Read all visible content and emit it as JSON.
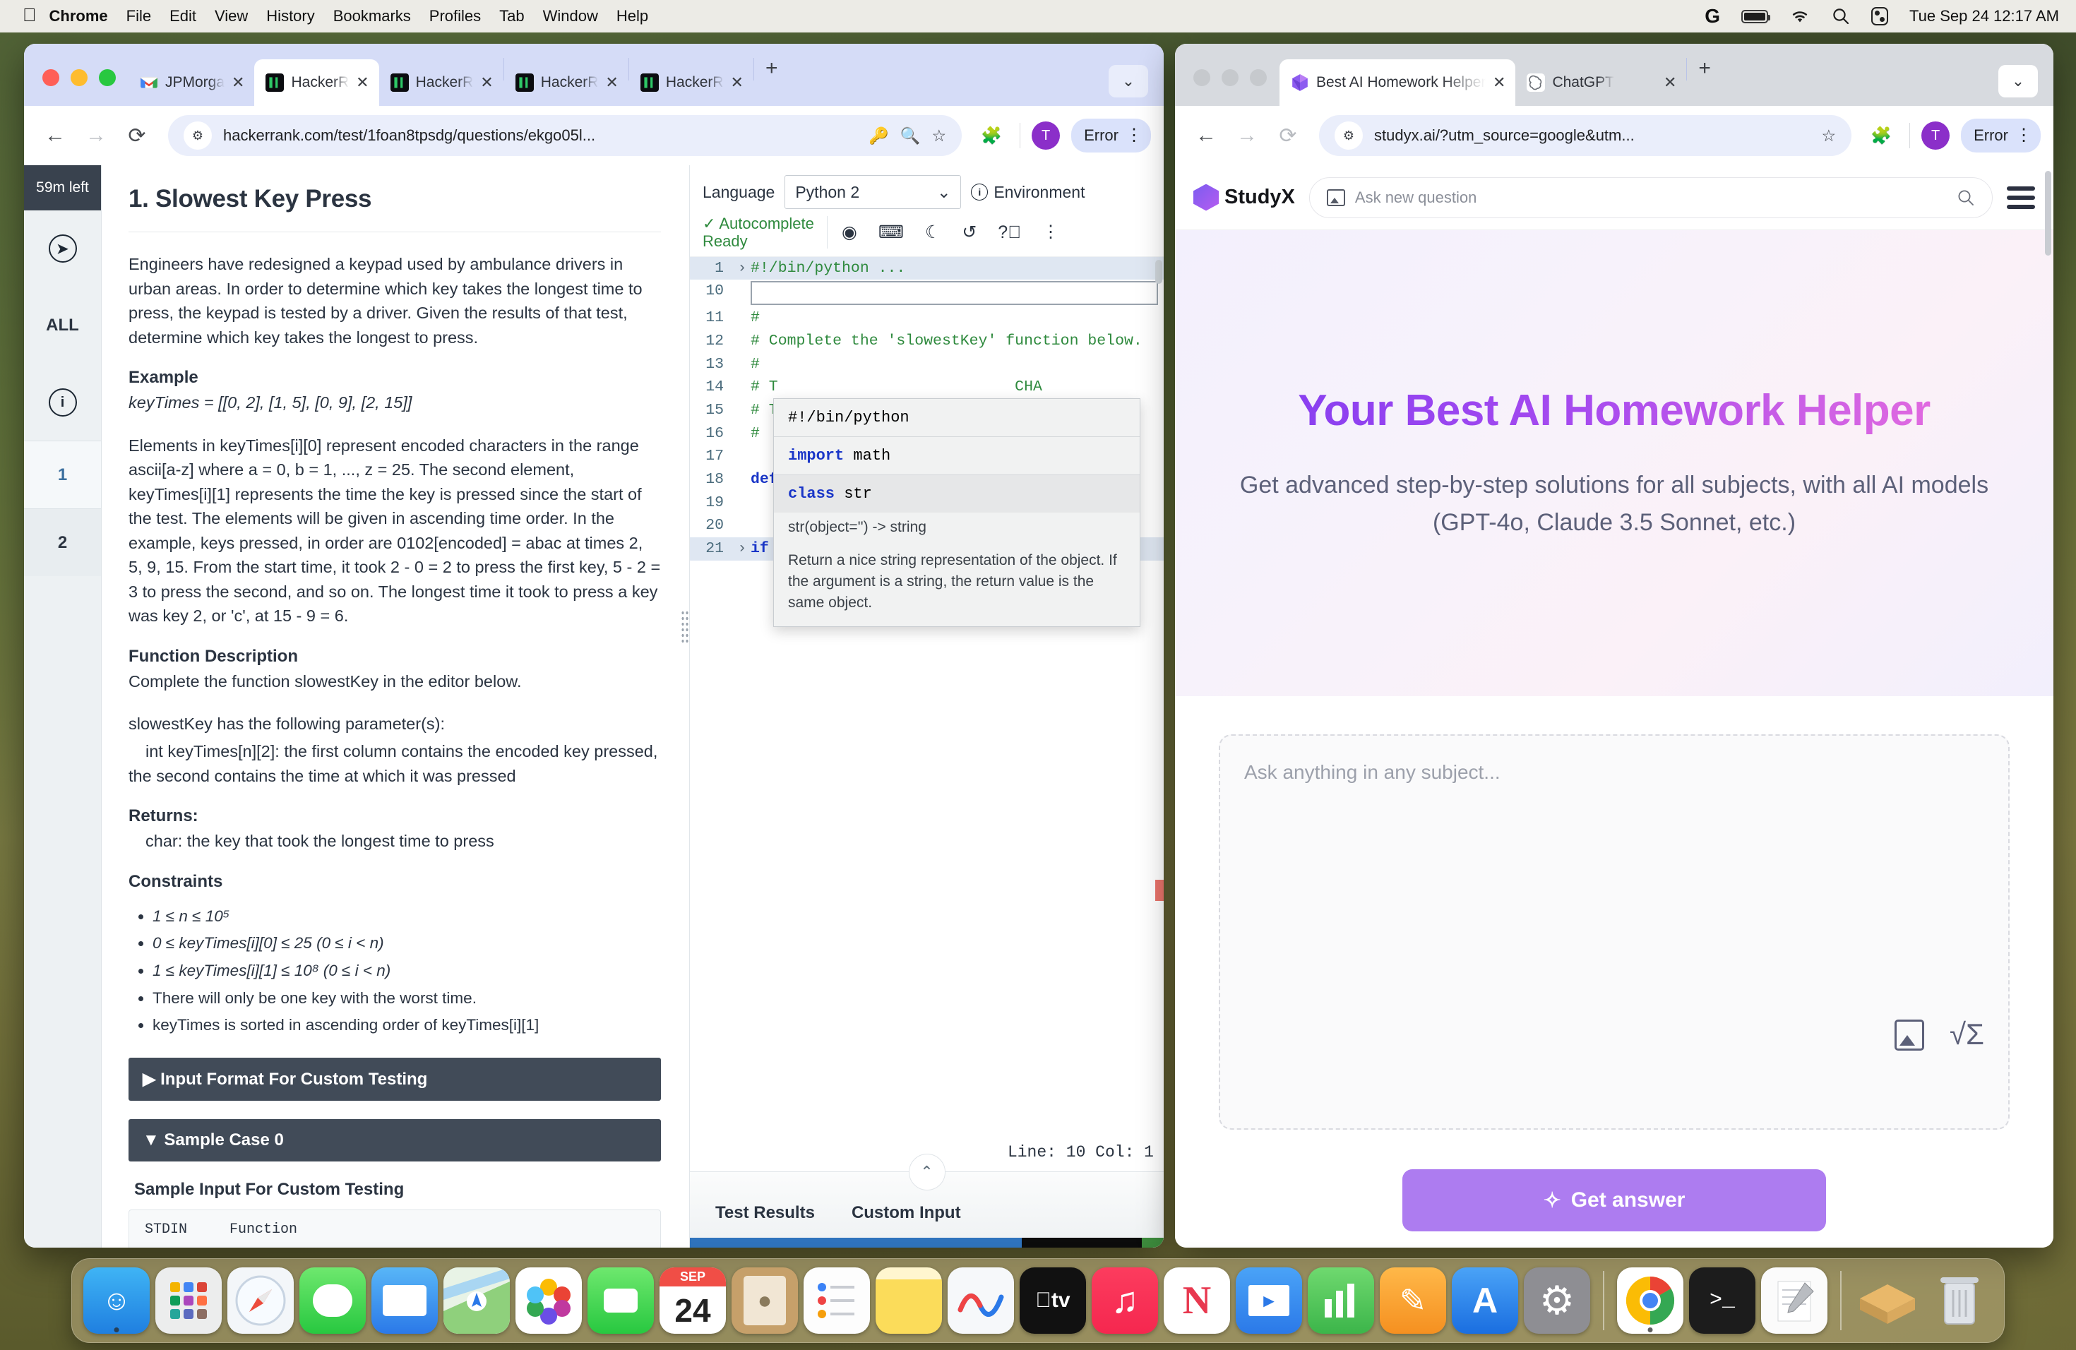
{
  "menubar": {
    "apple": "",
    "items": [
      "Chrome",
      "File",
      "Edit",
      "View",
      "History",
      "Bookmarks",
      "Profiles",
      "Tab",
      "Window",
      "Help"
    ],
    "status_icons": [
      "grammarly-icon",
      "battery-icon",
      "wifi-icon",
      "spotlight-search-icon",
      "control-center-icon"
    ],
    "clock": "Tue Sep 24  12:17 AM"
  },
  "left_window": {
    "tabs": [
      {
        "label": "JPMorga",
        "favicon": "gmail-icon",
        "active": false
      },
      {
        "label": "HackerR",
        "favicon": "hackerrank-icon",
        "active": true
      },
      {
        "label": "HackerR",
        "favicon": "hackerrank-icon",
        "active": false
      },
      {
        "label": "HackerR",
        "favicon": "hackerrank-icon",
        "active": false
      },
      {
        "label": "HackerR",
        "favicon": "hackerrank-icon",
        "active": false
      }
    ],
    "new_tab_label": "+",
    "tab_search_label": "⌄",
    "toolbar": {
      "back": "←",
      "forward": "→",
      "reload": "⟳",
      "url": "hackerrank.com/test/1foan8tpsdg/questions/ekgo05l...",
      "site_icon": "site-settings-icon",
      "omnibox_icons": [
        "password-key-icon",
        "search-icon",
        "bookmark-star-icon"
      ],
      "extensions": "extensions-puzzle-icon",
      "avatar_letter": "T",
      "error_label": "Error",
      "menu": "⋮"
    }
  },
  "hackerrank": {
    "timer": "59m left",
    "sidebar": {
      "nav_icon": "compass-icon",
      "all_label": "ALL",
      "info_icon": "info-icon",
      "questions": [
        "1",
        "2"
      ]
    },
    "title": "1. Slowest Key Press",
    "intro": "Engineers have redesigned a keypad used by ambulance drivers in urban areas. In order to determine which key takes the longest time to press, the keypad is tested by a driver. Given the results of that test, determine which key takes the longest to press.",
    "example_heading": "Example",
    "example_value": "keyTimes = [[0, 2], [1, 5], [0, 9], [2, 15]]",
    "explanation": "Elements in keyTimes[i][0] represent encoded characters in the range ascii[a-z] where a = 0, b = 1, ..., z = 25. The second element, keyTimes[i][1] represents the time the key is pressed since the start of the test.   The elements will be given in ascending time order. In the example, keys pressed, in order are 0102[encoded] = abac at times 2, 5, 9, 15.  From the start time, it took 2 - 0 = 2 to press the first key, 5 - 2 = 3 to press the second, and so on. The longest time it took to press a key was key 2, or 'c', at 15 - 9 = 6.",
    "func_desc_heading": "Function Description",
    "func_desc_body": "Complete the function slowestKey in the editor below.",
    "params_intro": "slowestKey has the following parameter(s):",
    "param_line": "int keyTimes[n][2]:  the first column contains the encoded key pressed, the second contains the time at which it was pressed",
    "returns_heading": "Returns:",
    "returns_body": "char: the key that took the longest time to press",
    "constraints_heading": "Constraints",
    "constraints": [
      "1 ≤ n ≤ 10⁵",
      "0 ≤ keyTimes[i][0] ≤ 25 (0 ≤ i < n)",
      "1 ≤ keyTimes[i][1] ≤ 10⁸ (0 ≤ i < n)",
      "There will only be one key with the worst time.",
      "keyTimes is sorted in ascending order of keyTimes[i][1]"
    ],
    "accordion_input_format": "▶ Input Format For Custom Testing",
    "accordion_sample_case": "▼ Sample Case 0",
    "sample_input_heading": "Sample Input For Custom Testing",
    "sample_cols": [
      "STDIN",
      "Function"
    ]
  },
  "editor": {
    "language_label": "Language",
    "language_value": "Python 2",
    "language_caret": "⌄",
    "environment_label": "Environment",
    "autocomplete_label": "Autocomplete Ready",
    "autocomplete_check": "✓",
    "tool_icons": [
      "eye-icon",
      "keyboard-icon",
      "moon-icon",
      "history-icon",
      "help-icon",
      "more-vertical-icon"
    ],
    "lines": [
      {
        "num": "1",
        "fold": "›",
        "text": "#!/bin/python ...",
        "kind": "comment",
        "highlight": true
      },
      {
        "num": "10",
        "fold": "",
        "text": "",
        "kind": "cursor"
      },
      {
        "num": "11",
        "fold": "",
        "text": "#",
        "kind": "comment"
      },
      {
        "num": "12",
        "fold": "",
        "text": "# Complete the 'slowestKey' function below.",
        "kind": "comment"
      },
      {
        "num": "13",
        "fold": "",
        "text": "#",
        "kind": "comment"
      },
      {
        "num": "14",
        "fold": "",
        "text": "# T                          CHA",
        "kind": "comment"
      },
      {
        "num": "15",
        "fold": "",
        "text": "# T                          key",
        "kind": "comment"
      },
      {
        "num": "16",
        "fold": "",
        "text": "#",
        "kind": "comment"
      },
      {
        "num": "17",
        "fold": "",
        "text": "",
        "kind": "plain"
      },
      {
        "num": "18",
        "fold": "",
        "text": "def",
        "kind": "keyword"
      },
      {
        "num": "19",
        "fold": "",
        "text": "",
        "kind": "plain"
      },
      {
        "num": "20",
        "fold": "",
        "text": "",
        "kind": "plain"
      },
      {
        "num": "21",
        "fold": "›",
        "text": "if __name__ == '__main__': ...",
        "kind": "code"
      }
    ],
    "autocomplete_popup": {
      "item1": "#!/bin/python",
      "item2": "import math",
      "item3": "class str",
      "doc_line1": "str(object='') -> string",
      "doc_line2": "Return a nice string representation of the object. If the argument is a string, the return value is the same object."
    },
    "line_col": "Line: 10 Col: 1",
    "collapse_icon": "⌃",
    "bottom_tabs": [
      "Test Results",
      "Custom Input"
    ]
  },
  "right_window": {
    "tabs": [
      {
        "label": "Best AI Homework Helper",
        "favicon": "studyx-icon",
        "active": true
      },
      {
        "label": "ChatGPT",
        "favicon": "chatgpt-icon",
        "active": false
      }
    ],
    "new_tab_label": "+",
    "tab_search_label": "⌄",
    "toolbar": {
      "back": "←",
      "forward": "→",
      "reload": "⟳",
      "url": "studyx.ai/?utm_source=google&utm...",
      "omnibox_icons": [
        "bookmark-star-icon"
      ],
      "extensions": "extensions-puzzle-icon",
      "avatar_letter": "T",
      "error_label": "Error",
      "menu": "⋮"
    }
  },
  "studyx": {
    "logo_text": "StudyX",
    "search_placeholder": "Ask new question",
    "hero_title": "Your Best AI Homework Helper",
    "hero_subtitle": "Get advanced step-by-step solutions for all subjects, with all AI models (GPT-4o, Claude 3.5 Sonnet, etc.)",
    "ask_placeholder": "Ask anything in any subject...",
    "ask_action_icons": [
      "image-upload-icon",
      "math-formula-icon"
    ],
    "get_answer_label": "Get answer",
    "get_answer_icon": "sparkle-icon",
    "accent_color": "#ad7cf0"
  },
  "dock": {
    "items": [
      {
        "name": "finder-icon",
        "color": "#1f9bf0",
        "glyph": "☺"
      },
      {
        "name": "launchpad-icon",
        "color": "#e9e9ea",
        "glyph": ""
      },
      {
        "name": "safari-icon",
        "color": "#f2f4f7",
        "glyph": "✦"
      },
      {
        "name": "messages-icon",
        "color": "#4cd964",
        "glyph": "○"
      },
      {
        "name": "mail-icon",
        "color": "#3e9cf5",
        "glyph": "✉"
      },
      {
        "name": "maps-icon",
        "color": "#6dce67",
        "glyph": "➤"
      },
      {
        "name": "photos-icon",
        "color": "#fdfdfd",
        "glyph": "✿"
      },
      {
        "name": "facetime-icon",
        "color": "#4cd964",
        "glyph": "▶"
      },
      {
        "name": "calendar-icon",
        "color": "#ffffff",
        "glyph": "24"
      },
      {
        "name": "contacts-icon",
        "color": "#c8a268",
        "glyph": "☻"
      },
      {
        "name": "reminders-icon",
        "color": "#fbfbfb",
        "glyph": "≡"
      },
      {
        "name": "notes-icon",
        "color": "#f7d155",
        "glyph": ""
      },
      {
        "name": "freeform-icon",
        "color": "#f4f6f8",
        "glyph": "〜"
      },
      {
        "name": "appletv-icon",
        "color": "#111111",
        "glyph": "tv"
      },
      {
        "name": "music-icon",
        "color": "#fa2d48",
        "glyph": "♪"
      },
      {
        "name": "news-icon",
        "color": "#ffffff",
        "glyph": "N"
      },
      {
        "name": "keynote-icon",
        "color": "#2b8cf0",
        "glyph": "▣"
      },
      {
        "name": "numbers-icon",
        "color": "#4ec84e",
        "glyph": "█"
      },
      {
        "name": "pages-icon",
        "color": "#f5a623",
        "glyph": "✎"
      },
      {
        "name": "appstore-icon",
        "color": "#2b8cf0",
        "glyph": "A"
      },
      {
        "name": "system-settings-icon",
        "color": "#8e8e93",
        "glyph": "⚙"
      },
      {
        "name": "chrome-icon",
        "color": "#ffffff",
        "glyph": "◉"
      },
      {
        "name": "terminal-icon",
        "color": "#1c1c1c",
        "glyph": ">_"
      },
      {
        "name": "textedit-icon",
        "color": "#fbfbfb",
        "glyph": "✐"
      },
      {
        "name": "downloads-stack-icon",
        "color": "#d8a75c",
        "glyph": "◢"
      },
      {
        "name": "trash-icon",
        "color": "#d7dade",
        "glyph": "ᴗ"
      }
    ]
  }
}
